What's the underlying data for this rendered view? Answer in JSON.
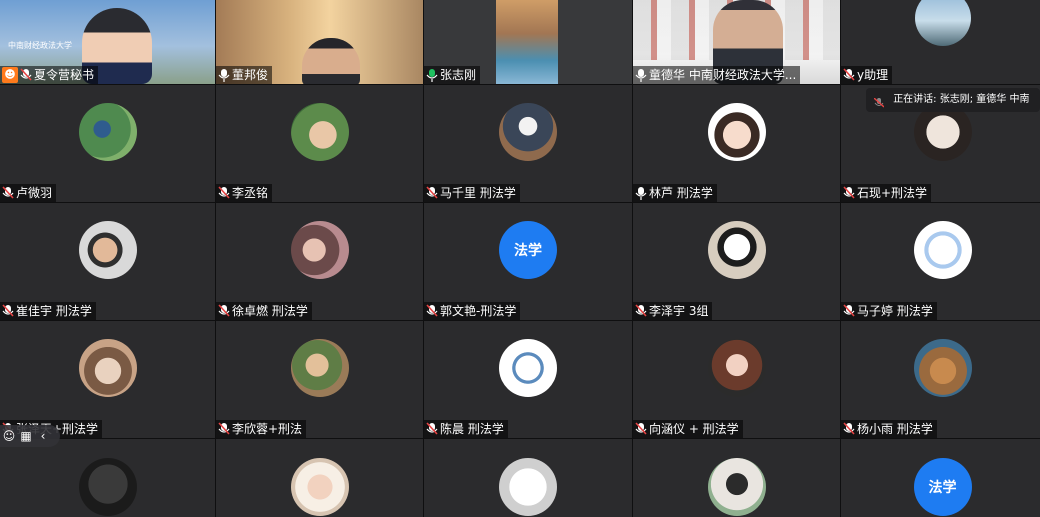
{
  "status": {
    "speaking_label": "正在讲话:",
    "speakers": "张志刚; 童德华",
    "speaking_overflow": "中南"
  },
  "participants": [
    {
      "name": "夏令营秘书"
    },
    {
      "name": "董邦俊"
    },
    {
      "name": "张志刚"
    },
    {
      "name": "童德华    中南财经政法大学..."
    },
    {
      "name": "y助理"
    },
    {
      "name": "卢微羽"
    },
    {
      "name": "李丞铭"
    },
    {
      "name": "马千里 刑法学"
    },
    {
      "name": "林芦 刑法学"
    },
    {
      "name": "石现+刑法学"
    },
    {
      "name": "崔佳宇 刑法学"
    },
    {
      "name": "徐卓燃 刑法学"
    },
    {
      "name": "郭文艳-刑法学"
    },
    {
      "name": "李泽宇 3组"
    },
    {
      "name": "马子婷 刑法学"
    },
    {
      "name": "张泽天+刑法学"
    },
    {
      "name": "李欣蓉+刑法"
    },
    {
      "name": "陈晨 刑法学"
    },
    {
      "name": "向涵仪 + 刑法学"
    },
    {
      "name": "杨小雨 刑法学"
    }
  ],
  "text_avatars": {
    "guo_wenyan": "法学",
    "bottom_right": "法学"
  },
  "icons": {
    "mic_color_speaking": "#20c261",
    "mic_color_muted": "#e64444",
    "mic_color_default": "#ffffff",
    "avatar_blue": "#1e7cf2"
  },
  "video_banner": "中南财经政法大学"
}
